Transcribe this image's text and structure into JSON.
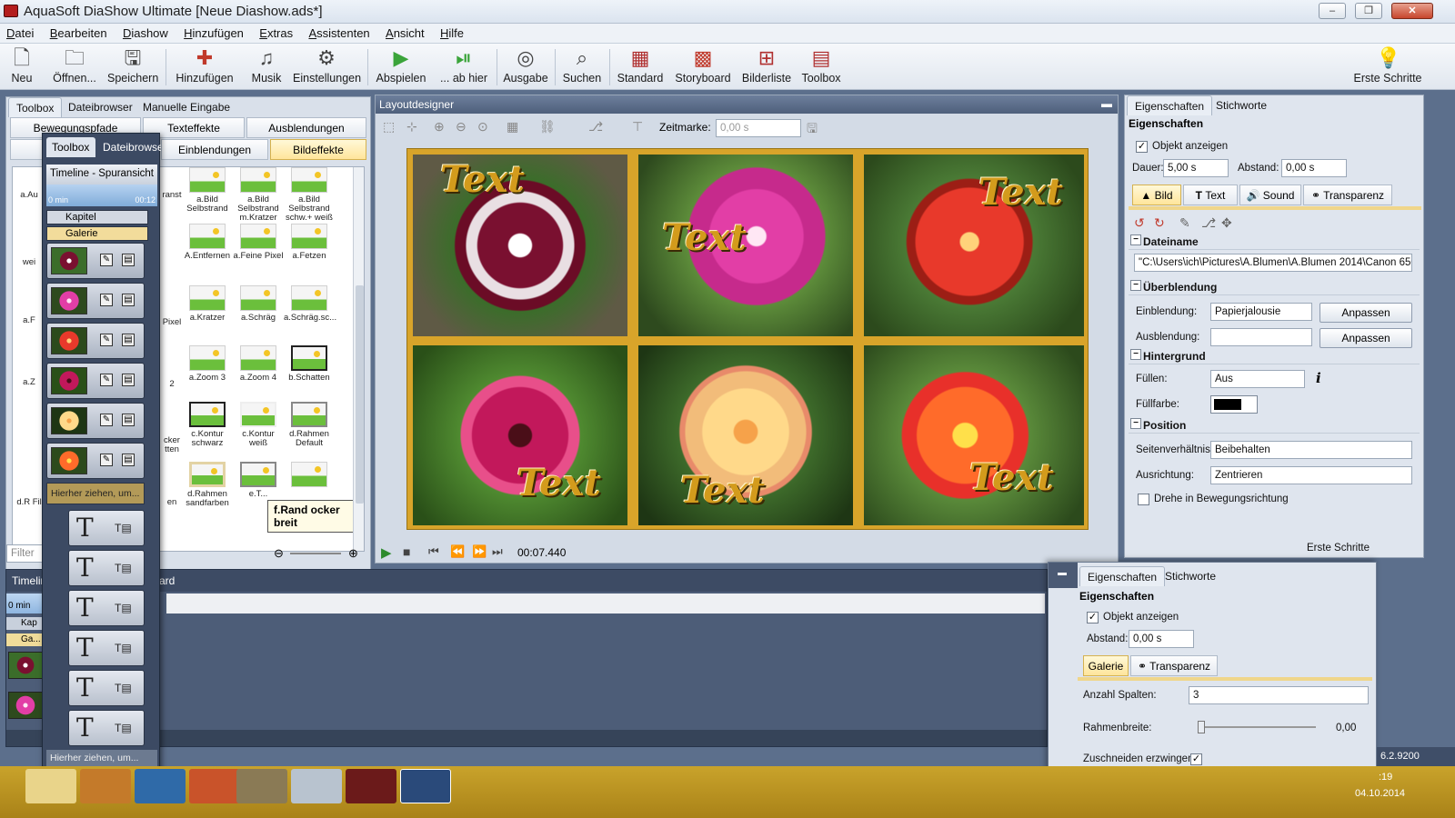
{
  "window": {
    "title": "AquaSoft DiaShow Ultimate [Neue Diashow.ads*]",
    "controls": {
      "minimize": "‒",
      "maximize": "❐",
      "close": "✕"
    }
  },
  "menu": [
    "Datei",
    "Bearbeiten",
    "Diashow",
    "Hinzufügen",
    "Extras",
    "Assistenten",
    "Ansicht",
    "Hilfe"
  ],
  "toolbar": {
    "neu": "Neu",
    "oeffnen": "Öffnen...",
    "speichern": "Speichern",
    "hinzufuegen": "Hinzufügen",
    "musik": "Musik",
    "einstellungen": "Einstellungen",
    "abspielen": "Abspielen",
    "ab_hier": "... ab hier",
    "ausgabe": "Ausgabe",
    "suchen": "Suchen",
    "standard": "Standard",
    "storyboard": "Storyboard",
    "bilderliste": "Bilderliste",
    "toolbox": "Toolbox",
    "erste_schritte": "Erste Schritte"
  },
  "left_panel": {
    "tabs": [
      "Toolbox",
      "Dateibrowser",
      "Manuelle Eingabe"
    ],
    "subtabs_row1": [
      "Bewegungspfade",
      "Texteffekte",
      "Ausblendungen"
    ],
    "subtabs_row2": [
      "Einblendungen",
      "Bildeffekte"
    ],
    "effects": [
      {
        "label": "a.Bild Selbstrand"
      },
      {
        "label": "a.Bild Selbstrand m.Kratzer"
      },
      {
        "label": "a.Bild Selbstrand schw.+ weiß"
      },
      {
        "label": "A.Entfernen"
      },
      {
        "label": "a.Feine Pixel"
      },
      {
        "label": "a.Fetzen"
      },
      {
        "label": "a.Kratzer"
      },
      {
        "label": "a.Schräg"
      },
      {
        "label": "a.Schräg.sc..."
      },
      {
        "label": "a.Zoom 3"
      },
      {
        "label": "a.Zoom 4"
      },
      {
        "label": "b.Schatten"
      },
      {
        "label": "c.Kontur schwarz"
      },
      {
        "label": "c.Kontur weiß"
      },
      {
        "label": "d.Rahmen Default"
      },
      {
        "label": "d.Rahmen sandfarben"
      },
      {
        "label": "e.T..."
      },
      {
        "label": ""
      }
    ],
    "left_column_labels": [
      "a.Au",
      "wei",
      "a.F",
      "a.Z",
      "d.R Film"
    ],
    "partial_labels": [
      "ranst",
      "Pixel",
      "2",
      "cker tten",
      "en"
    ],
    "tooltip": "f.Rand ocker breit",
    "filter_placeholder": "Filter"
  },
  "floating_timeline": {
    "tabs": [
      "Toolbox",
      "Dateibrowse"
    ],
    "header": "Timeline - Spuransicht",
    "ruler_start": "0 min",
    "ruler_end": "00:12",
    "kapitel": "Kapitel",
    "galerie": "Galerie",
    "drop_hint_1": "Hierher ziehen, um...",
    "drop_hint_2": "Hierher ziehen, um..."
  },
  "layout_designer": {
    "title": "Layoutdesigner",
    "zeitmarke_label": "Zeitmarke:",
    "zeitmarke_value": "0,00 s",
    "overlay_text": "Text",
    "time": "00:07.440"
  },
  "properties": {
    "tabs": [
      "Eigenschaften",
      "Stichworte"
    ],
    "heading": "Eigenschaften",
    "objekt_anzeigen": "Objekt anzeigen",
    "dauer_label": "Dauer:",
    "dauer_value": "5,00 s",
    "abstand_label": "Abstand:",
    "abstand_value": "0,00 s",
    "subtabs": [
      "Bild",
      "Text",
      "Sound",
      "Transparenz"
    ],
    "dateiname_h": "Dateiname",
    "dateiname_value": "\"C:\\Users\\ich\\Pictures\\A.Blumen\\A.Blumen 2014\\Canon 650",
    "ueberblendung_h": "Überblendung",
    "einblendung_label": "Einblendung:",
    "einblendung_value": "Papierjalousie",
    "ausblendung_label": "Ausblendung:",
    "ausblendung_value": "",
    "anpassen": "Anpassen",
    "hintergrund_h": "Hintergrund",
    "fuellen_label": "Füllen:",
    "fuellen_value": "Aus",
    "fuellfarbe_label": "Füllfarbe:",
    "position_h": "Position",
    "seitenverhaeltnis_label": "Seitenverhältnis:",
    "seitenverhaeltnis_value": "Beibehalten",
    "ausrichtung_label": "Ausrichtung:",
    "ausrichtung_value": "Zentrieren",
    "drehe_label": "Drehe in Bewegungsrichtung",
    "erste_schritte": "Erste Schritte"
  },
  "timeline_main": {
    "tab_partial": "Timelin",
    "tab_partial2": "ard",
    "ruler_start": "0 min",
    "kapitel": "Kap",
    "galerie": "Ga..."
  },
  "gallery_props": {
    "tabs": [
      "Eigenschaften",
      "Stichworte"
    ],
    "heading": "Eigenschaften",
    "objekt_anzeigen": "Objekt anzeigen",
    "abstand_label": "Abstand:",
    "abstand_value": "0,00 s",
    "subtabs": [
      "Galerie",
      "Transparenz"
    ],
    "spalten_label": "Anzahl Spalten:",
    "spalten_value": "3",
    "rahmen_label": "Rahmenbreite:",
    "rahmen_value": "0,00",
    "zuschneiden_label": "Zuschneiden erzwingen"
  },
  "status": {
    "version": "6.2.9200",
    "time_partial": ":19",
    "date": "04.10.2014"
  },
  "colors": {
    "frame_gold": "#d8a42a",
    "active_tab": "#ffe59b",
    "taskbar": "#c9a32b"
  }
}
